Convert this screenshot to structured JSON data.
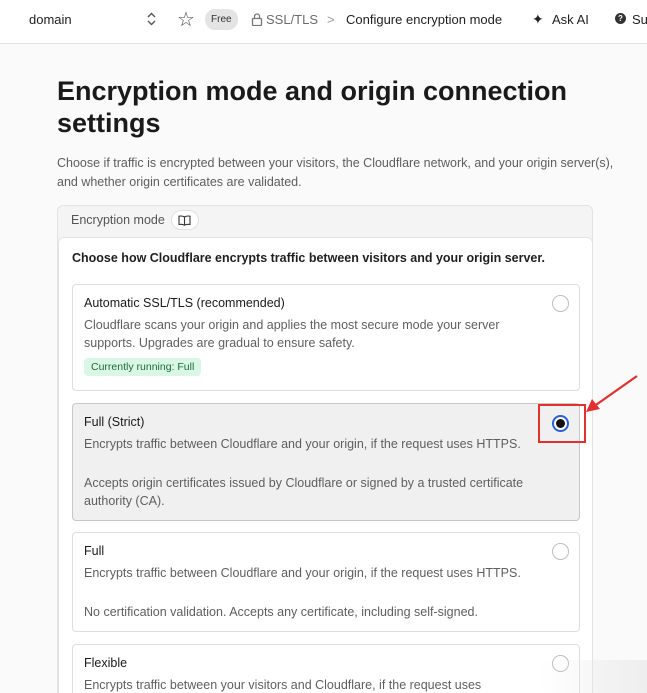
{
  "topbar": {
    "domain": "domain",
    "plan_badge": "Free",
    "breadcrumb_section": "SSL/TLS",
    "breadcrumb_separator": ">",
    "breadcrumb_current": "Configure encryption mode",
    "ask_ai": "Ask AI",
    "support": "Su"
  },
  "page": {
    "title": "Encryption mode and origin connection settings",
    "description": "Choose if traffic is encrypted between your visitors, the Cloudflare network, and your origin server(s), and whether origin certificates are validated."
  },
  "encryption_mode": {
    "label": "Encryption mode",
    "intro": "Choose how Cloudflare encrypts traffic between visitors and your origin server.",
    "options": [
      {
        "title": "Automatic SSL/TLS (recommended)",
        "description": "Cloudflare scans your origin and applies the most secure mode your server supports. Upgrades are gradual to ensure safety.",
        "badge": "Currently running: Full",
        "selected": false
      },
      {
        "title": "Full (Strict)",
        "description": "Encrypts traffic between Cloudflare and your origin, if the request uses HTTPS.",
        "description2": "Accepts origin certificates issued by Cloudflare or signed by a trusted certificate authority (CA).",
        "selected": true
      },
      {
        "title": "Full",
        "description": "Encrypts traffic between Cloudflare and your origin, if the request uses HTTPS.",
        "description2": "No certification validation. Accepts any certificate, including self-signed.",
        "selected": false
      },
      {
        "title": "Flexible",
        "description": "Encrypts traffic between your visitors and Cloudflare, if the request uses",
        "selected": false
      }
    ]
  },
  "icons": {
    "updown": "chevron-up-down-icon",
    "star": "star-icon",
    "lock": "lock-icon",
    "sparkle": "sparkle-icon",
    "help": "help-circle-icon",
    "docs": "book-icon"
  },
  "colors": {
    "selected_radio": "#2a5fd8",
    "badge_bg": "#d9f7e4",
    "badge_text": "#1d6b3a",
    "annotation": "#e03030"
  }
}
